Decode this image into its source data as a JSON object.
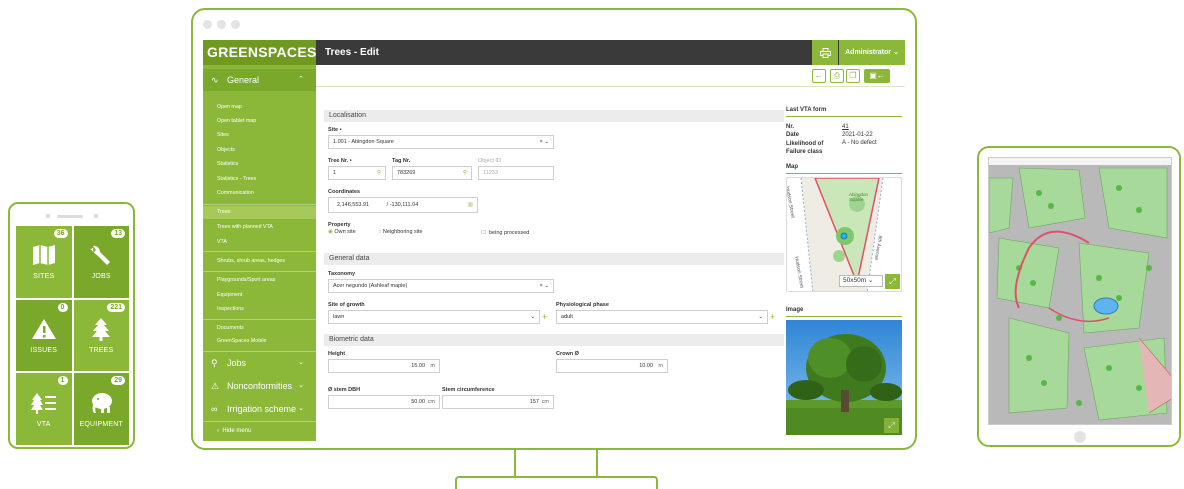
{
  "colors": {
    "accent": "#8cb83a",
    "accent_dark": "#6f9a1f",
    "topbar": "#3a3a3a"
  },
  "phone": {
    "tiles": [
      {
        "label": "SITES",
        "badge": "36",
        "icon": "map-icon"
      },
      {
        "label": "JOBS",
        "badge": "13",
        "icon": "wrench-icon"
      },
      {
        "label": "ISSUES",
        "badge": "0",
        "icon": "warning-icon"
      },
      {
        "label": "TREES",
        "badge": "221",
        "icon": "tree-icon"
      },
      {
        "label": "VTA",
        "badge": "1",
        "icon": "tree-list-icon"
      },
      {
        "label": "EQUIPMENT",
        "badge": "29",
        "icon": "elephant-icon"
      }
    ]
  },
  "app": {
    "brand": "GREENSPACES",
    "title": "Trees - Edit",
    "user": "Administrator",
    "sidebar": {
      "general": "General",
      "items": [
        "Open map",
        "Open tablet map",
        "Sites",
        "Objects",
        "Statistics",
        "Statistics - Trees",
        "Communication",
        "Trees",
        "Trees with planned VTA",
        "VTA",
        "Shrubs, shrub areas, hedges",
        "Playgrounds/Sport areas",
        "Equipment",
        "Inspections",
        "Documents",
        "GreenSpaces Mobile"
      ],
      "jobs": "Jobs",
      "nonconformities": "Nonconformities",
      "irrigation": "Irrigation scheme",
      "hide_menu": "Hide menu"
    },
    "form": {
      "localisation": "Localisation",
      "site_label": "Site •",
      "site_value": "1.001 - Abingdon Square",
      "tree_nr_label": "Tree Nr. •",
      "tree_nr_value": "1",
      "tag_nr_label": "Tag Nr.",
      "tag_nr_value": "783269",
      "object_id_label": "Object ID",
      "object_id_value": "11233",
      "coordinates_label": "Coordinates",
      "coord_x": "2,146,553.91",
      "coord_y": "/ -130,111.04",
      "property_label": "Property",
      "own_site": "Own site",
      "neighboring_site": "Neighboring site",
      "being_processed": "being processed",
      "general_data": "General data",
      "taxonomy_label": "Taxonomy",
      "taxonomy_value": "Acer negundo (Ashleaf maple)",
      "site_growth_label": "Site of growth",
      "site_growth_value": "lawn",
      "phys_phase_label": "Physiological phase",
      "phys_phase_value": "adult",
      "biometric": "Biometric data",
      "height_label": "Height",
      "height_value": "15.00",
      "height_unit": "m",
      "crown_label": "Crown Ø",
      "crown_value": "10.00",
      "crown_unit": "m",
      "stem_dbh_label": "Ø stem DBH",
      "stem_dbh_value": "50.00",
      "stem_dbh_unit": "cm",
      "stem_circ_label": "Stem circumference",
      "stem_circ_value": "157",
      "stem_circ_unit": "cm"
    },
    "right": {
      "vta_title": "Last VTA form",
      "nr_label": "Nr.",
      "nr_value": "41",
      "date_label": "Date",
      "date_value": "2021-01-22",
      "lof_label": "Likelihood of Failure class",
      "lof_value": "A - No defect",
      "map_title": "Map",
      "map_scale": "50x50m",
      "street_1": "Hudson Street",
      "street_2": "Hudson Street",
      "street_3": "8th Avenue",
      "place": "Abingdon Square",
      "image_title": "Image"
    }
  }
}
